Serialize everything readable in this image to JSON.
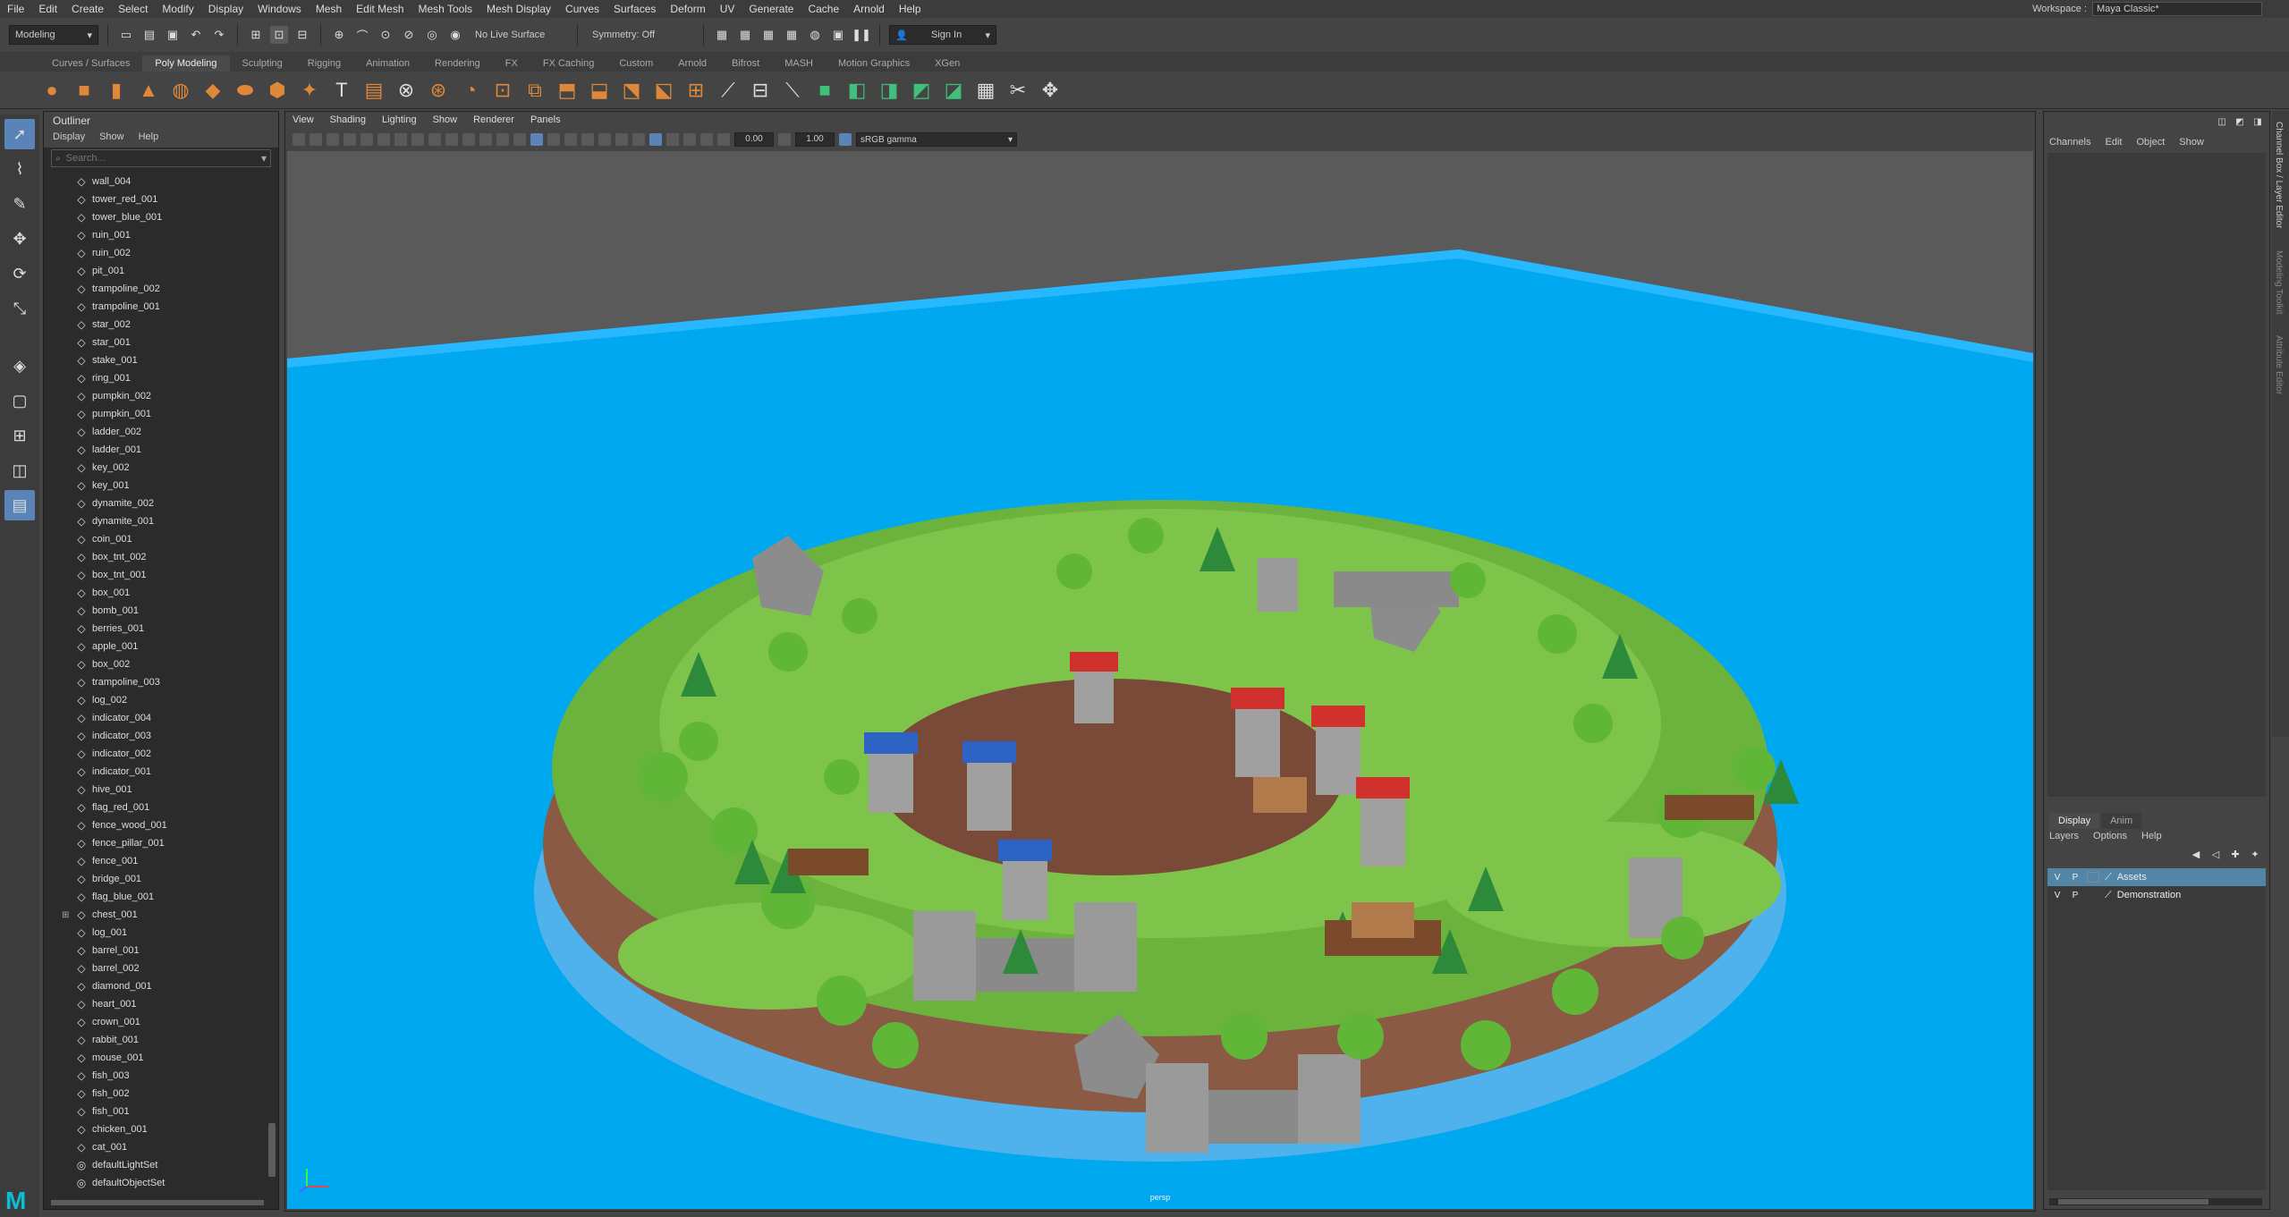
{
  "menubar": {
    "items": [
      "File",
      "Edit",
      "Create",
      "Select",
      "Modify",
      "Display",
      "Windows",
      "Mesh",
      "Edit Mesh",
      "Mesh Tools",
      "Mesh Display",
      "Curves",
      "Surfaces",
      "Deform",
      "UV",
      "Generate",
      "Cache",
      "Arnold",
      "Help"
    ],
    "workspace_label": "Workspace :",
    "workspace_value": "Maya Classic*"
  },
  "statusline": {
    "mode": "Modeling",
    "live_surface": "No Live Surface",
    "symmetry": "Symmetry: Off",
    "sign_in": "Sign In"
  },
  "shelf": {
    "tabs": [
      "Curves / Surfaces",
      "Poly Modeling",
      "Sculpting",
      "Rigging",
      "Animation",
      "Rendering",
      "FX",
      "FX Caching",
      "Custom",
      "Arnold",
      "Bifrost",
      "MASH",
      "Motion Graphics",
      "XGen"
    ],
    "active_tab": "Poly Modeling"
  },
  "outliner": {
    "title": "Outliner",
    "menu": [
      "Display",
      "Show",
      "Help"
    ],
    "search_placeholder": "Search...",
    "items": [
      "wall_004",
      "tower_red_001",
      "tower_blue_001",
      "ruin_001",
      "ruin_002",
      "pit_001",
      "trampoline_002",
      "trampoline_001",
      "star_002",
      "star_001",
      "stake_001",
      "ring_001",
      "pumpkin_002",
      "pumpkin_001",
      "ladder_002",
      "ladder_001",
      "key_002",
      "key_001",
      "dynamite_002",
      "dynamite_001",
      "coin_001",
      "box_tnt_002",
      "box_tnt_001",
      "box_001",
      "bomb_001",
      "berries_001",
      "apple_001",
      "box_002",
      "trampoline_003",
      "log_002",
      "indicator_004",
      "indicator_003",
      "indicator_002",
      "indicator_001",
      "hive_001",
      "flag_red_001",
      "fence_wood_001",
      "fence_pillar_001",
      "fence_001",
      "bridge_001",
      "flag_blue_001",
      "chest_001",
      "log_001",
      "barrel_001",
      "barrel_002",
      "diamond_001",
      "heart_001",
      "crown_001",
      "rabbit_001",
      "mouse_001",
      "fish_003",
      "fish_002",
      "fish_001",
      "chicken_001",
      "cat_001",
      "defaultLightSet",
      "defaultObjectSet"
    ]
  },
  "viewport": {
    "menu": [
      "View",
      "Shading",
      "Lighting",
      "Show",
      "Renderer",
      "Panels"
    ],
    "exposure": "0.00",
    "gamma": "1.00",
    "colorspace": "sRGB gamma",
    "camera": "persp"
  },
  "channelbox": {
    "menu": [
      "Channels",
      "Edit",
      "Object",
      "Show"
    ],
    "layer_tabs": [
      "Display",
      "Anim"
    ],
    "layer_menu": [
      "Layers",
      "Options",
      "Help"
    ],
    "layers": [
      {
        "v": "V",
        "p": "P",
        "name": "Assets"
      },
      {
        "v": "V",
        "p": "P",
        "name": "Demonstration"
      }
    ]
  },
  "side_tabs": [
    "Channel Box / Layer Editor",
    "Modeling Toolkit",
    "Attribute Editor"
  ],
  "colors": {
    "water": "#00a8f0",
    "grass": "#6bb33c",
    "dirt": "#8a5a44",
    "accent_select": "#5285a6"
  }
}
